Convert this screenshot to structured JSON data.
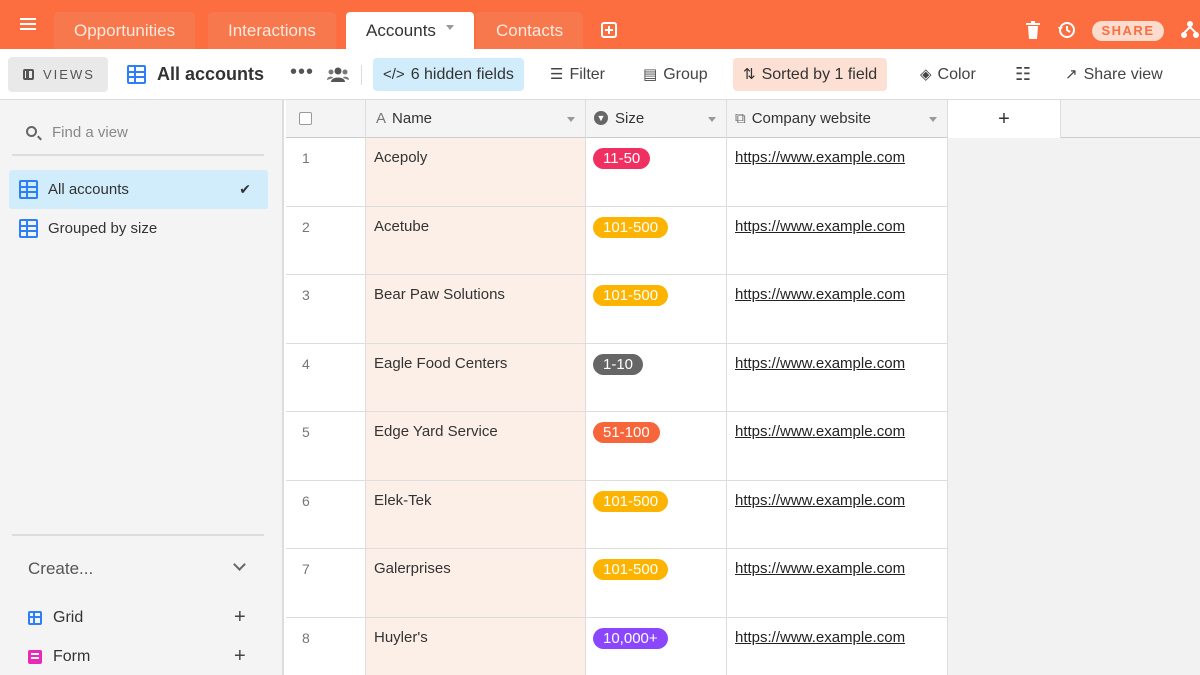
{
  "tabs": [
    {
      "label": "Opportunities",
      "active": false
    },
    {
      "label": "Interactions",
      "active": false
    },
    {
      "label": "Accounts",
      "active": true
    },
    {
      "label": "Contacts",
      "active": false
    }
  ],
  "topbar": {
    "share_label": "SHARE"
  },
  "toolbar": {
    "views_label": "VIEWS",
    "view_title": "All accounts",
    "hidden_fields": "6 hidden fields",
    "filter": "Filter",
    "group": "Group",
    "sorted": "Sorted by 1 field",
    "color": "Color",
    "share_view": "Share view"
  },
  "sidebar": {
    "find_placeholder": "Find a view",
    "views": [
      {
        "label": "All accounts",
        "active": true
      },
      {
        "label": "Grouped by size",
        "active": false
      }
    ],
    "create_label": "Create...",
    "create_items": [
      {
        "label": "Grid"
      },
      {
        "label": "Form"
      }
    ]
  },
  "grid": {
    "columns": {
      "name": "Name",
      "size": "Size",
      "website": "Company website",
      "add": "+"
    },
    "rows": [
      {
        "num": "1",
        "name": "Acepoly",
        "size": "11-50",
        "size_color": "#ef3061",
        "website": "https://www.example.com"
      },
      {
        "num": "2",
        "name": "Acetube",
        "size": "101-500",
        "size_color": "#fcb400",
        "website": "https://www.example.com"
      },
      {
        "num": "3",
        "name": "Bear Paw Solutions",
        "size": "101-500",
        "size_color": "#fcb400",
        "website": "https://www.example.com"
      },
      {
        "num": "4",
        "name": "Eagle Food Centers",
        "size": "1-10",
        "size_color": "#666666",
        "website": "https://www.example.com"
      },
      {
        "num": "5",
        "name": "Edge Yard Service",
        "size": "51-100",
        "size_color": "#f7653b",
        "website": "https://www.example.com"
      },
      {
        "num": "6",
        "name": "Elek-Tek",
        "size": "101-500",
        "size_color": "#fcb400",
        "website": "https://www.example.com"
      },
      {
        "num": "7",
        "name": "Galerprises",
        "size": "101-500",
        "size_color": "#fcb400",
        "website": "https://www.example.com"
      },
      {
        "num": "8",
        "name": "Huyler's",
        "size": "10,000+",
        "size_color": "#8b46ff",
        "website": "https://www.example.com"
      }
    ]
  },
  "colors": {
    "brand": "#fc6d3f",
    "accent_blue": "#2d7ff9",
    "selected_bg": "#d1ecfb"
  }
}
